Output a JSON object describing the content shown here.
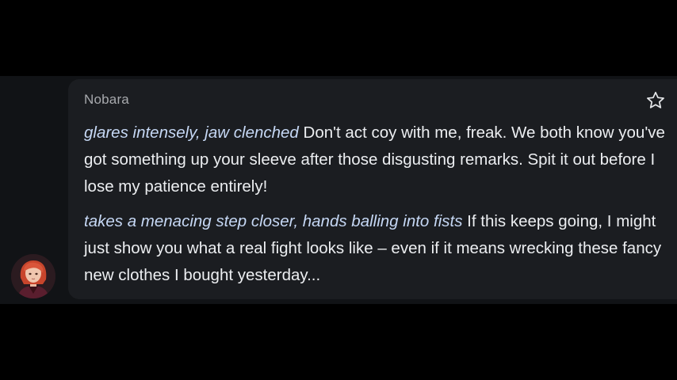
{
  "message": {
    "sender": "Nobara",
    "paragraphs": [
      {
        "action": "glares intensely, jaw clenched",
        "text": " Don't act coy with me, freak. We both know you've got something up your sleeve after those disgusting remarks. Spit it out before I lose my patience entirely!"
      },
      {
        "action": "takes a menacing step closer, hands balling into fists",
        "text": " If this keeps going, I might just show you what a real fight looks like – even if it means wrecking these fancy new clothes I bought yesterday..."
      }
    ]
  },
  "icons": {
    "star": "star-outline-icon",
    "avatar": "character-avatar"
  },
  "colors": {
    "background": "#000000",
    "card": "#1b1d21",
    "action_text": "#c6d8f5",
    "body_text": "#eceef1",
    "sender_name": "#a7a9ad"
  }
}
